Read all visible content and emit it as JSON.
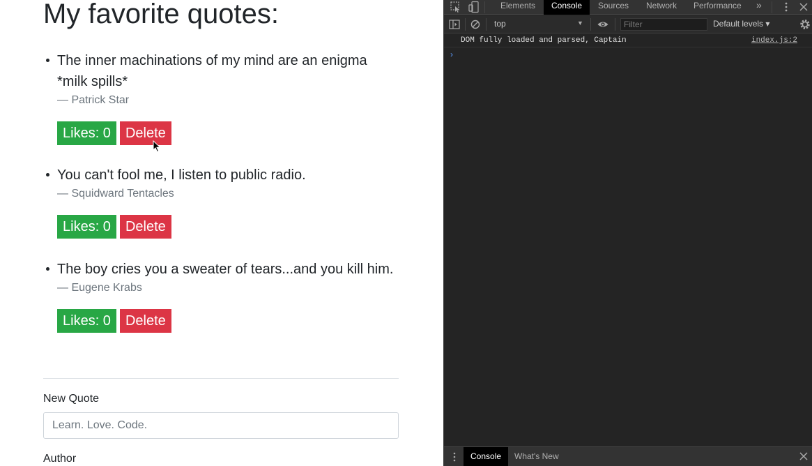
{
  "page": {
    "title": "My favorite quotes:",
    "quotes": [
      {
        "text": "The inner machinations of my mind are an enigma\n*milk spills*",
        "author": "— Patrick Star",
        "likes_label": "Likes: 0",
        "delete_label": "Delete"
      },
      {
        "text": "You can't fool me, I listen to public radio.",
        "author": "— Squidward Tentacles",
        "likes_label": "Likes: 0",
        "delete_label": "Delete"
      },
      {
        "text": "The boy cries you a sweater of tears...and you kill him.",
        "author": "— Eugene Krabs",
        "likes_label": "Likes: 0",
        "delete_label": "Delete"
      }
    ],
    "form": {
      "new_quote_label": "New Quote",
      "new_quote_placeholder": "Learn. Love. Code.",
      "author_label": "Author"
    }
  },
  "devtools": {
    "tabs": [
      "Elements",
      "Console",
      "Sources",
      "Network",
      "Performance"
    ],
    "active_tab": "Console",
    "more_tabs": "»",
    "context": "top",
    "filter_placeholder": "Filter",
    "levels": "Default levels ▾",
    "log": {
      "message": "DOM fully loaded and parsed, Captain",
      "source": "index.js:2"
    },
    "prompt": "›",
    "drawer_tabs": [
      "Console",
      "What's New"
    ],
    "colors": {
      "accent": "#5d9cff",
      "like": "#28a745",
      "delete": "#dc3545"
    }
  }
}
